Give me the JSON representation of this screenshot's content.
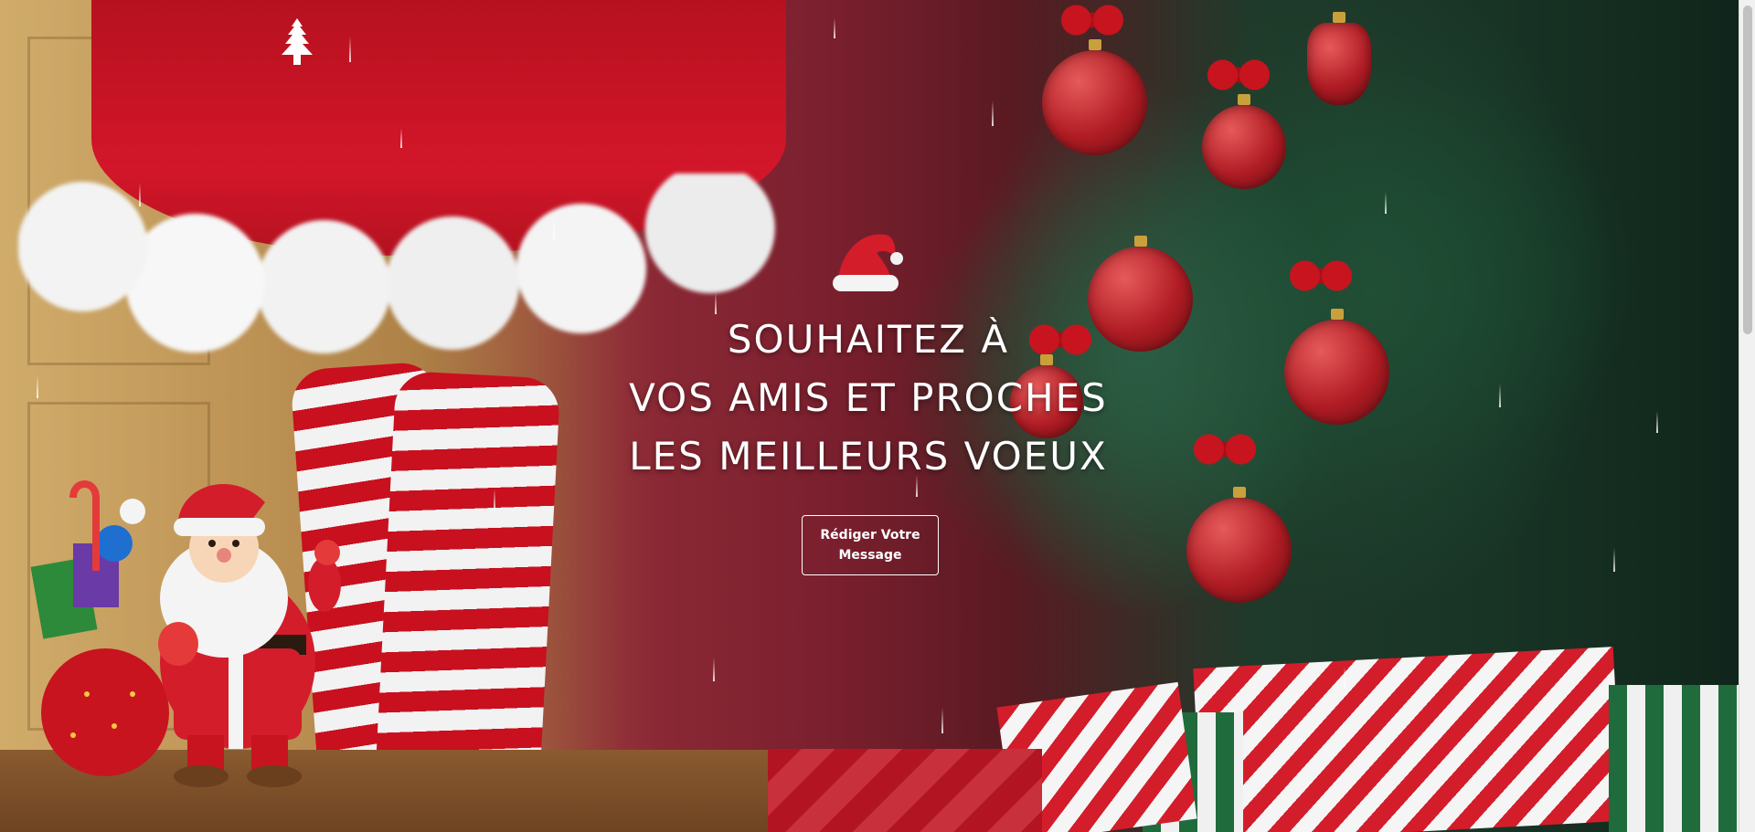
{
  "header": {
    "logo_icon": "christmas-tree-icon"
  },
  "hero": {
    "decor_icon": "santa-hat-icon",
    "headline": {
      "line1": "SOUHAITEZ À",
      "line2": "VOS AMIS ET PROCHES",
      "line3": "LES MEILLEURS VOEUX"
    },
    "cta_label": "Rédiger Votre Message"
  },
  "decorations": {
    "santa": "santa-claus-illustration"
  },
  "colors": {
    "text": "#ffffff",
    "accent_red": "#c8141f",
    "tree_green": "#1f6b3c"
  }
}
